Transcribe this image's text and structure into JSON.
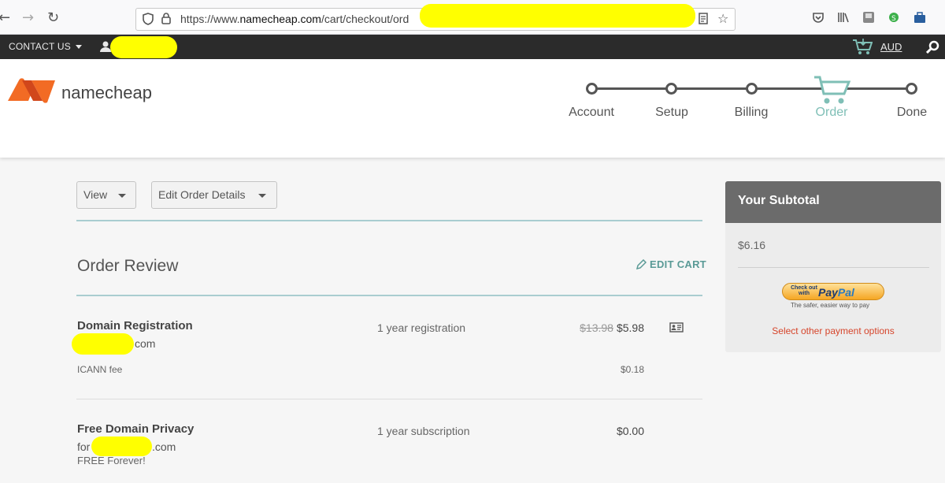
{
  "browser": {
    "url_prefix": "https://www.",
    "url_host": "namecheap.com",
    "url_path": "/cart/checkout/ord"
  },
  "topbar": {
    "contact_label": "CONTACT US",
    "currency": "AUD"
  },
  "header": {
    "brand": "namecheap",
    "steps": [
      "Account",
      "Setup",
      "Billing",
      "Order",
      "Done"
    ],
    "active_step": "Order"
  },
  "controls": {
    "view_label": "View",
    "edit_details_label": "Edit Order Details"
  },
  "order": {
    "title": "Order Review",
    "edit_cart_label": "EDIT CART",
    "items": [
      {
        "title": "Domain Registration",
        "domain_suffix": "com",
        "term": "1 year registration",
        "old_price": "$13.98",
        "price": "$5.98",
        "fee_label": "ICANN fee",
        "fee_price": "$0.18"
      },
      {
        "title": "Free Domain Privacy",
        "domain_prefix": "for",
        "domain_suffix": ".com",
        "term": "1 year subscription",
        "price": "$0.00",
        "note": "FREE Forever!"
      }
    ]
  },
  "subtotal": {
    "heading": "Your Subtotal",
    "amount": "$6.16",
    "paypal_small": "Check out with",
    "paypal_pay": "Pay",
    "paypal_pal": "Pal",
    "paypal_tagline": "The safer, easier way to pay",
    "other_options": "Select other payment options"
  },
  "colors": {
    "accent_teal": "#7fbfb6",
    "brand_orange": "#f26b24",
    "link_red": "#d6452b",
    "redaction": "#ffff00"
  }
}
